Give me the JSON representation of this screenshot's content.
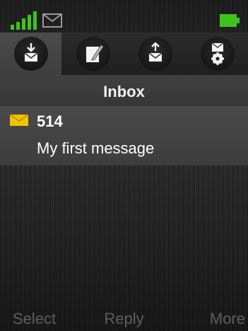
{
  "status_bar": {
    "signal_icon": "signal-bars-icon",
    "message_icon": "envelope-outline-icon",
    "battery_icon": "battery-icon",
    "signal_color": "#3cc41c",
    "battery_color": "#3cc41c"
  },
  "tabs": [
    {
      "icon": "inbox-download-icon",
      "active": true
    },
    {
      "icon": "compose-pencil-icon",
      "active": false
    },
    {
      "icon": "outbox-upload-icon",
      "active": false
    },
    {
      "icon": "message-settings-gear-icon",
      "active": false
    }
  ],
  "header": {
    "title": "Inbox"
  },
  "messages": [
    {
      "icon": "unread-envelope-icon",
      "sender": "514",
      "preview": "My first message",
      "icon_color": "#f2c200"
    }
  ],
  "softkeys": {
    "left": "Select",
    "center": "Reply",
    "right": "More"
  }
}
